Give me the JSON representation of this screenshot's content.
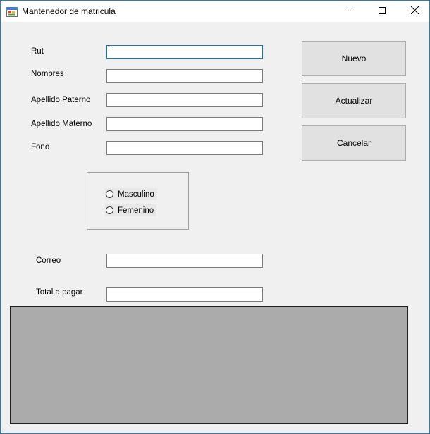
{
  "window": {
    "title": "Mantenedor de matricula",
    "icons": [
      "app-icon",
      "minimize-icon",
      "maximize-icon",
      "close-icon"
    ]
  },
  "form": {
    "rut_label": "Rut",
    "nombres_label": "Nombres",
    "apellido_paterno_label": "Apellido Paterno",
    "apellido_materno_label": "Apellido Materno",
    "fono_label": "Fono",
    "correo_label": "Correo",
    "total_label": "Total a pagar",
    "rut_value": "",
    "nombres_value": "",
    "apellido_paterno_value": "",
    "apellido_materno_value": "",
    "fono_value": "",
    "correo_value": "",
    "total_value": ""
  },
  "gender": {
    "options": [
      "Masculino",
      "Femenino"
    ],
    "selected": null
  },
  "buttons": {
    "nuevo": "Nuevo",
    "actualizar": "Actualizar",
    "cancelar": "Cancelar"
  },
  "colors": {
    "focus_border": "#0078d7",
    "window_border": "#2b78c5",
    "grid_background": "#ababab"
  }
}
